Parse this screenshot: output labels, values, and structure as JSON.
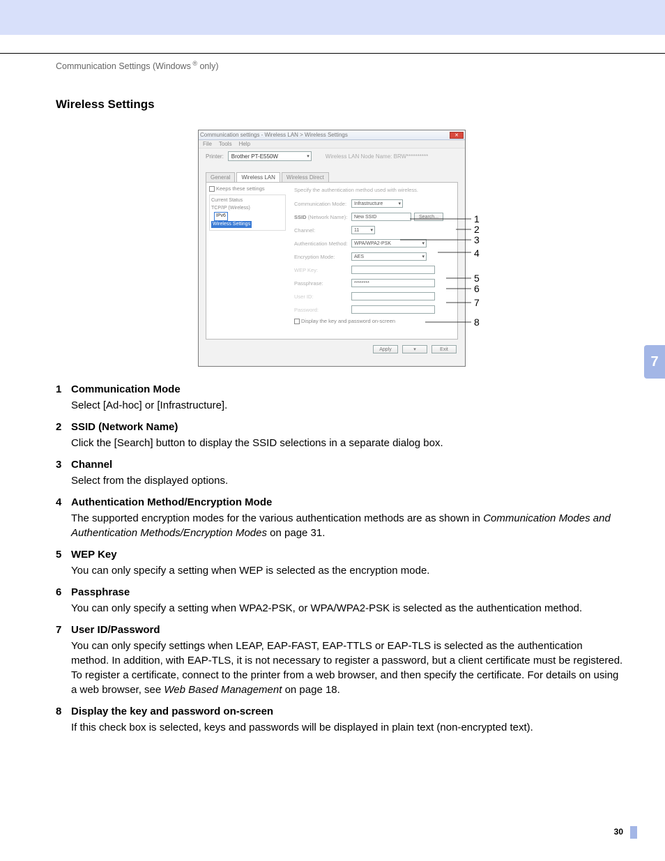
{
  "header": "Communication Settings (Windows ® only)",
  "section_title": "Wireless Settings",
  "chapter": "7",
  "page_number": "30",
  "dialog": {
    "title": "Communication settings - Wireless LAN > Wireless Settings",
    "menu": [
      "File",
      "Tools",
      "Help"
    ],
    "printer_label": "Printer:",
    "printer_value": "Brother PT-E550W",
    "node_name": "Wireless LAN Node Name: BRW**********",
    "tabs": [
      "General",
      "Wireless LAN",
      "Wireless Direct"
    ],
    "keep_settings": "Keeps these settings",
    "tree": {
      "current_status": "Current Status",
      "tcpip": "TCP/IP (Wireless)",
      "ipv6": "IPv6",
      "wireless_settings": "Wireless Settings"
    },
    "desc": "Specify the authentication method used with wireless.",
    "fields": {
      "comm_mode": {
        "label": "Communication Mode:",
        "value": "Infrastructure"
      },
      "ssid": {
        "label": "SSID (Network Name):",
        "value": "New SSID",
        "button": "Search..."
      },
      "channel": {
        "label": "Channel:",
        "value": "11"
      },
      "auth": {
        "label": "Authentication Method:",
        "value": "WPA/WPA2-PSK"
      },
      "enc": {
        "label": "Encryption Mode:",
        "value": "AES"
      },
      "wep": {
        "label": "WEP Key:",
        "value": ""
      },
      "pass": {
        "label": "Passphrase:",
        "value": "********"
      },
      "userid": {
        "label": "User ID:",
        "value": ""
      },
      "password": {
        "label": "Password:",
        "value": ""
      },
      "display_chk": "Display the key and password on-screen"
    },
    "footer": {
      "apply": "Apply",
      "exit": "Exit"
    }
  },
  "callout_nums": [
    "1",
    "2",
    "3",
    "4",
    "5",
    "6",
    "7",
    "8"
  ],
  "items": [
    {
      "num": "1",
      "title": "Communication Mode",
      "body": "Select [Ad-hoc] or [Infrastructure]."
    },
    {
      "num": "2",
      "title": "SSID (Network Name)",
      "body": "Click the [Search] button to display the SSID selections in a separate dialog box."
    },
    {
      "num": "3",
      "title": "Channel",
      "body": "Select from the displayed options."
    },
    {
      "num": "4",
      "title": "Authentication Method/Encryption Mode",
      "body_pre": "The supported encryption modes for the various authentication methods are as shown in ",
      "body_em": "Communication Modes and Authentication Methods/Encryption Modes",
      "body_post": " on page 31."
    },
    {
      "num": "5",
      "title": "WEP Key",
      "body": "You can only specify a setting when WEP is selected as the encryption mode."
    },
    {
      "num": "6",
      "title": "Passphrase",
      "body": "You can only specify a setting when WPA2-PSK, or WPA/WPA2-PSK is selected as the authentication method."
    },
    {
      "num": "7",
      "title": "User ID/Password",
      "body_pre": "You can only specify settings when LEAP, EAP-FAST, EAP-TTLS or EAP-TLS is selected as the authentication method. In addition, with EAP-TLS, it is not necessary to register a password, but a client certificate must be registered. To register a certificate, connect to the printer from a web browser, and then specify the certificate. For details on using a web browser, see ",
      "body_em": "Web Based Management",
      "body_post": " on page 18."
    },
    {
      "num": "8",
      "title": "Display the key and password on-screen",
      "body": "If this check box is selected, keys and passwords will be displayed in plain text (non-encrypted text)."
    }
  ]
}
